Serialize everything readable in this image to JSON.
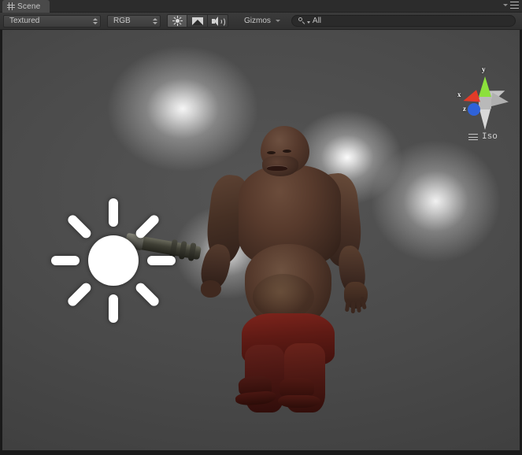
{
  "window": {
    "tab_label": "Scene",
    "tab_icon": "grid-hash-icon",
    "menu_icon": "hamburger-menu-icon",
    "menu_arrow_icon": "triangle-down-icon"
  },
  "toolbar": {
    "draw_mode": {
      "value": "Textured",
      "icon": "updown-arrows-icon"
    },
    "render_mode": {
      "value": "RGB",
      "icon": "updown-arrows-icon"
    },
    "toggles": [
      {
        "name": "lighting-toggle",
        "icon": "sun-icon",
        "active": true
      },
      {
        "name": "fx-toggle",
        "icon": "image-fx-icon",
        "active": false
      },
      {
        "name": "audio-toggle",
        "icon": "speaker-icon",
        "active": false
      }
    ],
    "gizmos": {
      "label": "Gizmos",
      "icon": "triangle-down-icon"
    },
    "search": {
      "value": "All",
      "placeholder": "All",
      "icon": "search-magnifier-icon",
      "dropdown_icon": "triangle-down-icon"
    }
  },
  "scene": {
    "axis_gizmo": {
      "name": "scene-view-axis-gizmo",
      "axes": [
        {
          "label": "x",
          "color": "#e23b28"
        },
        {
          "label": "y",
          "color": "#8ce03c"
        },
        {
          "label": "z",
          "color": "#2f62d8"
        }
      ],
      "projection_label": "Iso",
      "projection_icon": "hamburger-icon"
    },
    "light_gizmo": {
      "name": "point-light-gizmo",
      "icon": "sun-light-icon",
      "ray_count": 8
    },
    "objects": [
      {
        "name": "monster-character-model"
      },
      {
        "name": "flashlight-weapon-model"
      }
    ],
    "background_color": "#454545",
    "glow_color": "#ffffff"
  }
}
